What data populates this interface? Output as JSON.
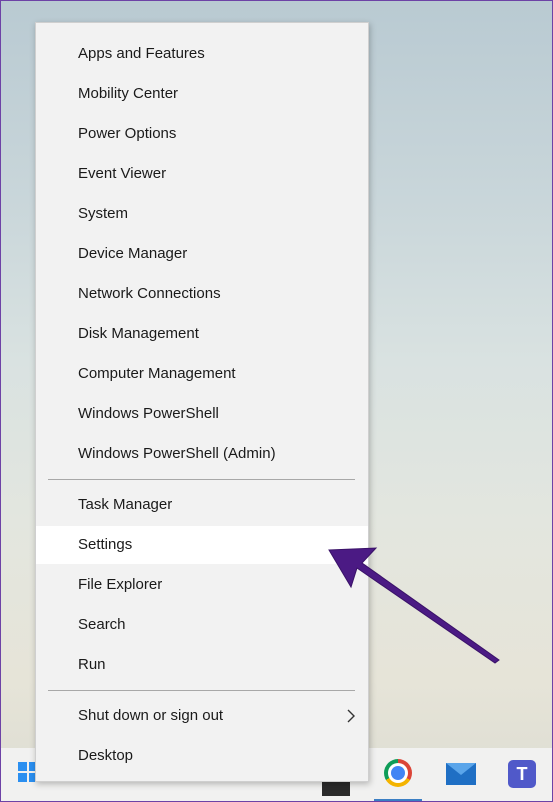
{
  "menu": {
    "group1": [
      {
        "label": "Apps and Features"
      },
      {
        "label": "Mobility Center"
      },
      {
        "label": "Power Options"
      },
      {
        "label": "Event Viewer"
      },
      {
        "label": "System"
      },
      {
        "label": "Device Manager"
      },
      {
        "label": "Network Connections"
      },
      {
        "label": "Disk Management"
      },
      {
        "label": "Computer Management"
      },
      {
        "label": "Windows PowerShell"
      },
      {
        "label": "Windows PowerShell (Admin)"
      }
    ],
    "group2": [
      {
        "label": "Task Manager"
      },
      {
        "label": "Settings"
      },
      {
        "label": "File Explorer"
      },
      {
        "label": "Search"
      },
      {
        "label": "Run"
      }
    ],
    "group3": [
      {
        "label": "Shut down or sign out"
      },
      {
        "label": "Desktop"
      }
    ],
    "highlighted_item": "Settings"
  },
  "taskbar": {
    "icons": [
      "windows-start-icon",
      "chrome-icon",
      "mail-icon",
      "teams-icon"
    ]
  },
  "colors": {
    "arrow": "#4b1a84",
    "start_blue": "#2b8ff0",
    "menu_bg": "#f2f2f2"
  }
}
